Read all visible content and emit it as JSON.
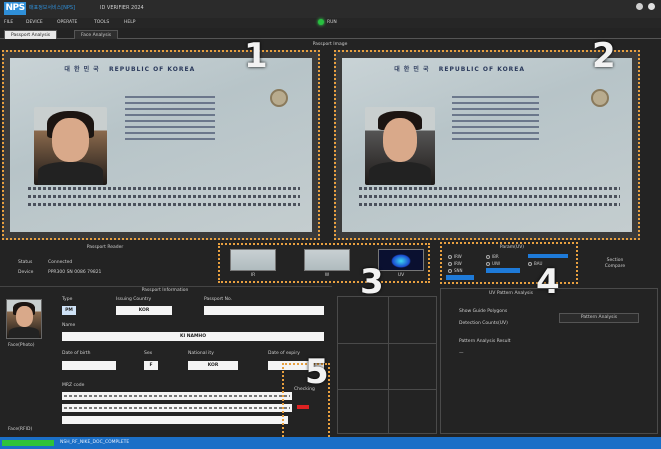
{
  "window": {
    "logo": "NPS",
    "logo_subtitle": "매표정보서비스[NPS]",
    "title": "ID VERIFIER 2024"
  },
  "menu": {
    "items": [
      "FILE",
      "DEVICE",
      "OPERATE",
      "TOOLS",
      "HELP"
    ],
    "run_label": "RUN"
  },
  "tabs": [
    {
      "label": "Passport Analysis",
      "active": true
    },
    {
      "label": "Face Analysis",
      "active": false
    }
  ],
  "passport_image_label": "Passport Image",
  "passport_reader": {
    "title": "Passport Reader",
    "status_label": "Status",
    "status_value": "Connected",
    "device_label": "Device",
    "device_value": "PPR300 SN 0086 79821"
  },
  "thumbnails": [
    {
      "label": "IR"
    },
    {
      "label": "W"
    },
    {
      "label": "UV"
    }
  ],
  "params": {
    "title": "Param(UV)",
    "options": [
      "IRW",
      "IRW",
      "SNN",
      "IBR",
      "UIW",
      "BAU"
    ]
  },
  "section_compare": "Section\nCompare",
  "passport_info": {
    "title": "Passport Information",
    "type_label": "Type",
    "type_value": "PM",
    "issuing_country_label": "Issuing Country",
    "issuing_country_value": "KOR",
    "passport_no_label": "Passport No.",
    "passport_no_value": "",
    "name_label": "Name",
    "name_value": "KI NAMHO",
    "dob_label": "Date of birth",
    "dob_value": "",
    "sex_label": "Sex",
    "sex_value": "F",
    "nationality_label": "National ity",
    "nationality_value": "KOR",
    "expiry_label": "Date of expiry",
    "expiry_value": "",
    "mrz_label": "MRZ code",
    "face_photo_label": "Face(Photo)",
    "face_rfid_label": "Face(RFID)",
    "check_label": "Checking"
  },
  "uv_analysis": {
    "title": "UV Pattern Analysis",
    "option_label": "Show Guide Polygons",
    "detection_label": "Detection Counts(UV)",
    "pattern_button": "Pattern Analysis",
    "result_label": "Pattern Analysis Result",
    "result_value": "—"
  },
  "annotations": [
    "1",
    "2",
    "3",
    "4",
    "5"
  ],
  "status_bar": {
    "progress": 1.0,
    "text": "NSH_RF_NIKE_DOC_COMPLETE"
  },
  "colors": {
    "accent": "#1b6fc7",
    "highlight": "#e8a040",
    "run_led": "#28c040"
  }
}
